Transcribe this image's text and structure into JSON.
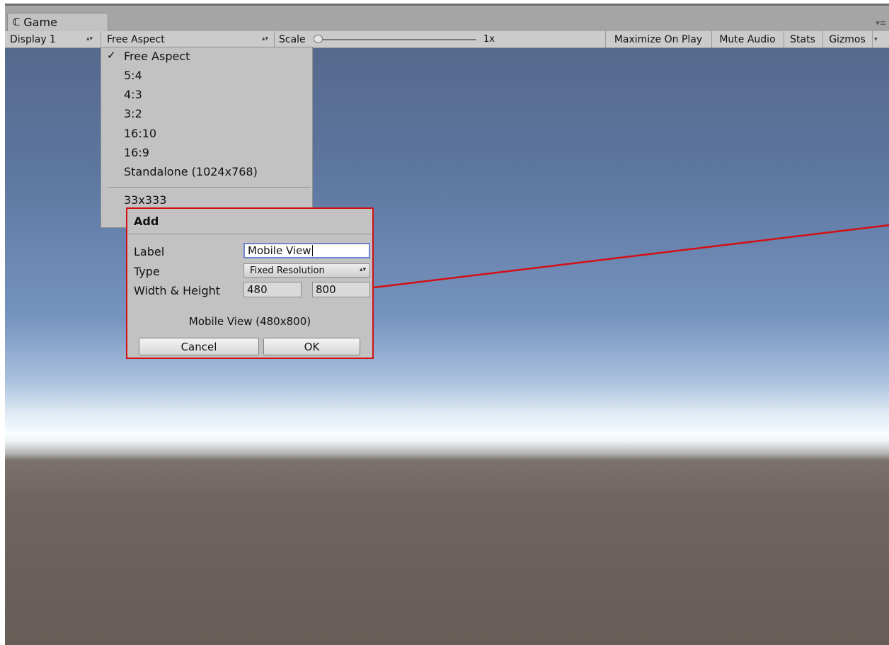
{
  "tab": {
    "icon": "unity-logo-icon",
    "title": "Game"
  },
  "panel_menu_icon": "panel-menu-icon",
  "toolbar": {
    "display": "Display 1",
    "aspect": "Free Aspect",
    "scale_label": "Scale",
    "scale_value": "1x",
    "maximize_on_play": "Maximize On Play",
    "mute_audio": "Mute Audio",
    "stats": "Stats",
    "gizmos": "Gizmos"
  },
  "dropdown": {
    "items": [
      {
        "label": "Free Aspect",
        "checked": true
      },
      {
        "label": "5:4"
      },
      {
        "label": "4:3"
      },
      {
        "label": "3:2"
      },
      {
        "label": "16:10"
      },
      {
        "label": "16:9"
      },
      {
        "label": "Standalone (1024x768)"
      }
    ],
    "custom_items": [
      {
        "label": "33x333"
      }
    ],
    "check_glyph": "✓"
  },
  "dialog": {
    "title": "Add",
    "label_label": "Label",
    "label_value": "Mobile View",
    "type_label": "Type",
    "type_value": "Fixed Resolution",
    "size_label": "Width & Height",
    "width": "480",
    "height": "800",
    "summary": "Mobile View (480x800)",
    "cancel": "Cancel",
    "ok": "OK"
  },
  "colors": {
    "highlight": "#d40f14",
    "focus_border": "#6f84c9",
    "sky_top": "#56698d",
    "ground": "#675d58"
  }
}
